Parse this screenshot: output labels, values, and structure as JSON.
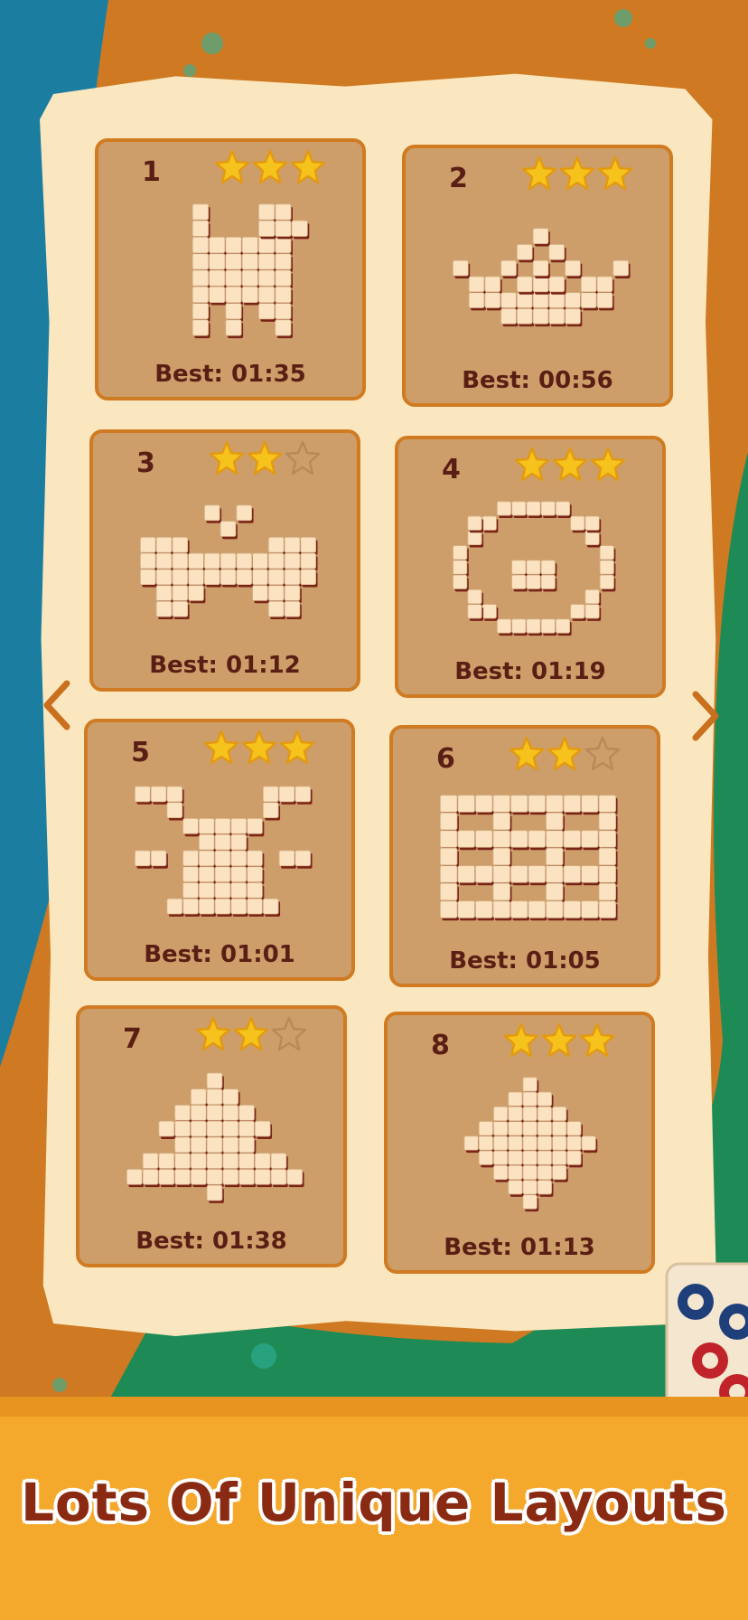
{
  "colors": {
    "teal": "#1b7ea1",
    "orange_floor": "#cf7a22",
    "green": "#1e8a55",
    "parchment": "#fbe7bf",
    "card_fill": "#cd9e6a",
    "card_border": "#d07b22",
    "text_dark": "#5a1e14",
    "star_gold": "#f6c21c",
    "banner": "#f5a92c",
    "headline": "#8a2a12"
  },
  "levels": [
    {
      "number": "1",
      "stars": 3,
      "best": "Best: 01:35",
      "shape": "cat-icon"
    },
    {
      "number": "2",
      "stars": 3,
      "best": "Best: 00:56",
      "shape": "crown-icon"
    },
    {
      "number": "3",
      "stars": 2,
      "best": "Best: 01:12",
      "shape": "bow-icon"
    },
    {
      "number": "4",
      "stars": 3,
      "best": "Best: 01:19",
      "shape": "ring-icon"
    },
    {
      "number": "5",
      "stars": 3,
      "best": "Best: 01:01",
      "shape": "bug-icon"
    },
    {
      "number": "6",
      "stars": 2,
      "best": "Best: 01:05",
      "shape": "square-icon"
    },
    {
      "number": "7",
      "stars": 2,
      "best": "Best: 01:38",
      "shape": "tree-icon"
    },
    {
      "number": "8",
      "stars": 3,
      "best": "Best: 01:13",
      "shape": "diamond-icon"
    }
  ],
  "nav": {
    "prev_icon": "chevron-left-icon",
    "next_icon": "chevron-right-icon"
  },
  "headline": "Lots Of Unique Layouts"
}
